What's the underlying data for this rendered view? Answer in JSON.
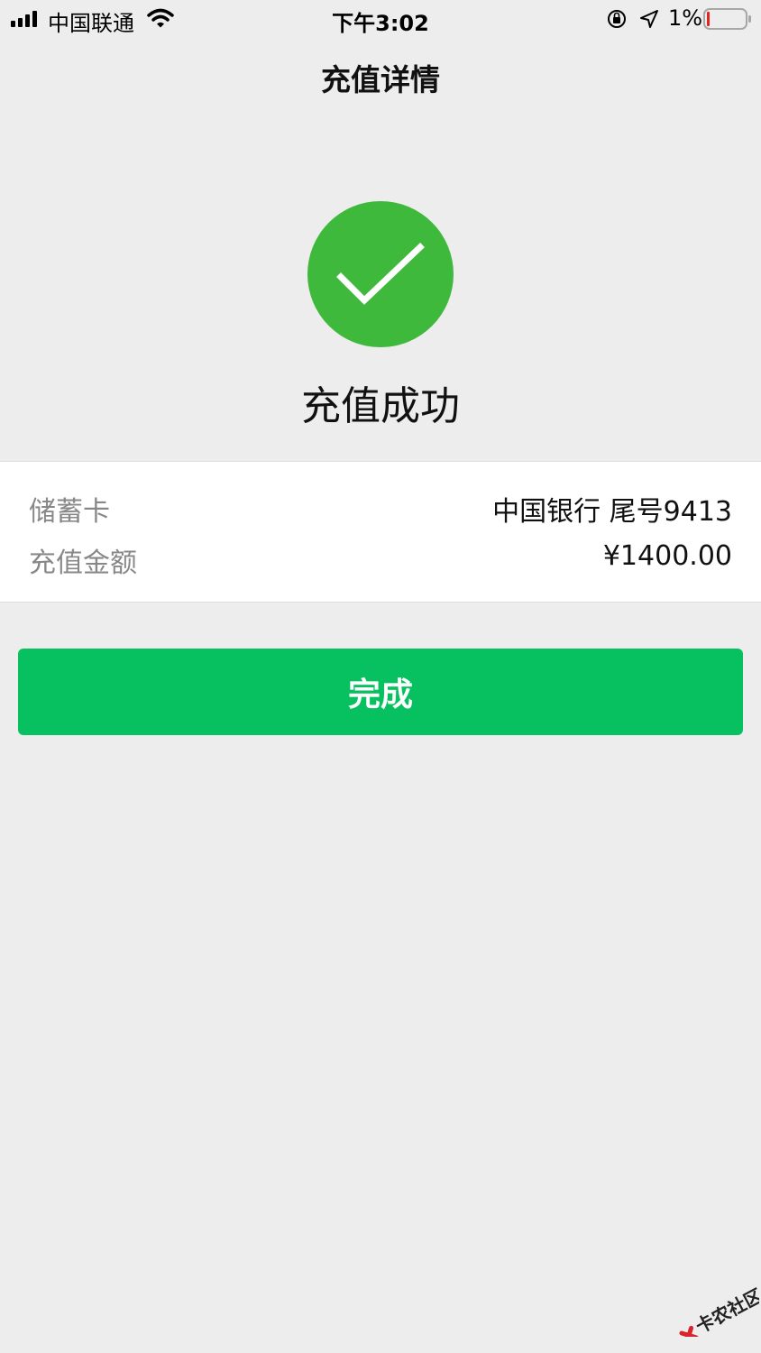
{
  "status_bar": {
    "carrier": "中国联通",
    "time": "下午3:02",
    "battery": "1%"
  },
  "nav": {
    "title": "充值详情"
  },
  "result": {
    "icon": "check-circle-icon",
    "icon_color": "#3eb93b",
    "message": "充值成功"
  },
  "details": {
    "rows": [
      {
        "label": "储蓄卡",
        "value": "中国银行 尾号9413"
      },
      {
        "label": "充值金额",
        "value": "¥1400.00"
      }
    ]
  },
  "actions": {
    "done_label": "完成",
    "done_color": "#07c160"
  },
  "watermark": {
    "text": "卡农社区"
  }
}
